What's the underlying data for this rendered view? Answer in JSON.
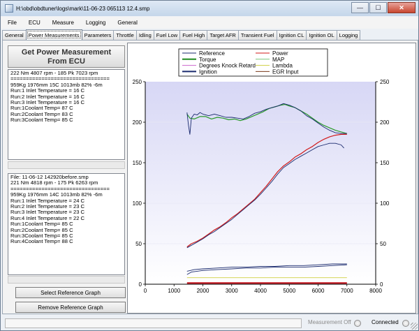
{
  "window": {
    "title": "H:\\obd\\obdtuner\\logs\\mark\\11-06-23 065113 12.4.smp",
    "min_glyph": "—",
    "max_glyph": "☐",
    "close_glyph": "✕"
  },
  "menu": [
    "File",
    "ECU",
    "Measure",
    "Logging",
    "General"
  ],
  "tabs": [
    "General",
    "Power Measurements",
    "Parameters",
    "Throttle",
    "Idling",
    "Fuel Low",
    "Fuel High",
    "Target AFR",
    "Transient Fuel",
    "Ignition CL",
    "Ignition OL",
    "Logging"
  ],
  "active_tab": "Power Measurements",
  "left": {
    "get_power_button": [
      "Get Power Measurement",
      "From ECU"
    ],
    "current_panel": [
      "222 Nm 4807 rpm - 185 Pk 7023 rpm",
      "================================",
      "959Kg 1976mm 15C 1013mb 82% -6m",
      "Run:1 Inlet Temperature = 16 C",
      "Run:2 Inlet Temperature = 16 C",
      "Run:3 Inlet Temperature = 16 C",
      "Run:1Coolant Temp= 87 C",
      "Run:2Coolant Temp= 83 C",
      "Run:3Coolant Temp= 85 C"
    ],
    "reference_panel": [
      "File: 11-06-12 142920before.smp",
      "221 Nm 4818 rpm - 175 Pk 6263 rpm",
      "================================",
      "959Kg 1976mm 14C 1013mb 82% -6m",
      "Run:1 Inlet Temperature = 24 C",
      "Run:2 Inlet Temperature = 23 C",
      "Run:3 Inlet Temperature = 23 C",
      "Run:4 Inlet Temperature = 22 C",
      "Run:1Coolant Temp= 85 C",
      "Run:2Coolant Temp= 85 C",
      "Run:3Coolant Temp= 85 C",
      "Run:4Coolant Temp= 88 C"
    ],
    "select_reference_button": "Select Reference Graph",
    "remove_reference_button": "Remove Reference Graph"
  },
  "status": {
    "measurement": "Measurement Off",
    "connected": "Connected"
  },
  "chart_data": {
    "type": "line",
    "x_ticks": [
      0,
      1000,
      2000,
      3000,
      4000,
      5000,
      6000,
      7000,
      8000
    ],
    "y_ticks": [
      0,
      50,
      100,
      150,
      200,
      250
    ],
    "xlim": [
      0,
      8000
    ],
    "ylim": [
      0,
      250
    ],
    "legend_position": "top",
    "legend": [
      {
        "name": "Reference",
        "color": "#1a2a6e",
        "width": 1
      },
      {
        "name": "Power",
        "color": "#d11a1a",
        "width": 1
      },
      {
        "name": "Torque",
        "color": "#1f8a1f",
        "width": 2
      },
      {
        "name": "MAP",
        "color": "#7cc57c",
        "width": 1
      },
      {
        "name": "Degrees Knock Retard",
        "color": "#cc66cc",
        "width": 1
      },
      {
        "name": "Lambda",
        "color": "#cfcf40",
        "width": 1
      },
      {
        "name": "Ignition",
        "color": "#1a2a6e",
        "width": 2
      },
      {
        "name": "EGR Input",
        "color": "#7a3a1a",
        "width": 1
      }
    ],
    "series": [
      {
        "name": "Torque",
        "color": "#2a9a2a",
        "width": 1.2,
        "x": [
          1450,
          1550,
          1700,
          1900,
          2100,
          2300,
          2500,
          2700,
          2900,
          3100,
          3300,
          3500,
          3700,
          3900,
          4100,
          4300,
          4500,
          4700,
          4850,
          5000,
          5200,
          5400,
          5600,
          5800,
          6000,
          6200,
          6400,
          6600,
          6800,
          7000
        ],
        "y": [
          210,
          205,
          204,
          207,
          207,
          204,
          206,
          205,
          203,
          204,
          202,
          204,
          207,
          210,
          213,
          217,
          219,
          221,
          222,
          220,
          218,
          214,
          210,
          205,
          200,
          196,
          193,
          190,
          188,
          186
        ]
      },
      {
        "name": "Power",
        "color": "#d11a1a",
        "width": 1.2,
        "x": [
          1450,
          1600,
          1800,
          2000,
          2200,
          2400,
          2600,
          2800,
          3000,
          3200,
          3400,
          3600,
          3800,
          4000,
          4200,
          4400,
          4600,
          4800,
          5000,
          5200,
          5400,
          5600,
          5800,
          6000,
          6200,
          6400,
          6600,
          6800,
          7000
        ],
        "y": [
          46,
          50,
          53,
          57,
          62,
          67,
          71,
          76,
          82,
          87,
          93,
          99,
          105,
          113,
          121,
          130,
          139,
          146,
          151,
          157,
          161,
          166,
          170,
          175,
          179,
          182,
          184,
          185,
          185
        ]
      },
      {
        "name": "Reference torque",
        "color": "#1a2a6e",
        "width": 0.9,
        "x": [
          1450,
          1500,
          1550,
          1600,
          1700,
          1800,
          1900,
          2000,
          2200,
          2400,
          2600,
          2800,
          3000,
          3200,
          3400,
          3600,
          3800,
          4000,
          4200,
          4400,
          4600,
          4800,
          5000,
          5200,
          5400,
          5600,
          5800,
          6000,
          6200,
          6400,
          6600,
          6800,
          7000
        ],
        "y": [
          212,
          196,
          185,
          205,
          210,
          209,
          212,
          210,
          208,
          210,
          208,
          206,
          206,
          205,
          204,
          207,
          211,
          213,
          216,
          218,
          220,
          223,
          221,
          218,
          214,
          208,
          204,
          199,
          194,
          190,
          187,
          186,
          186
        ]
      },
      {
        "name": "Reference power",
        "color": "#1a2a6e",
        "width": 0.9,
        "x": [
          1450,
          1600,
          1800,
          2000,
          2200,
          2400,
          2600,
          2800,
          3000,
          3200,
          3400,
          3600,
          3800,
          4000,
          4200,
          4400,
          4600,
          4800,
          5000,
          5200,
          5400,
          5600,
          5800,
          6000,
          6200,
          6400,
          6600,
          6800,
          6900
        ],
        "y": [
          45,
          48,
          52,
          56,
          61,
          65,
          70,
          75,
          80,
          86,
          92,
          98,
          104,
          111,
          119,
          127,
          136,
          144,
          149,
          154,
          158,
          162,
          166,
          170,
          172,
          174,
          174,
          172,
          168
        ]
      },
      {
        "name": "Ignition",
        "color": "#1a2a6e",
        "width": 0.9,
        "x": [
          1450,
          1600,
          2000,
          2500,
          3000,
          3500,
          4000,
          4500,
          5000,
          5500,
          6000,
          6500,
          7000
        ],
        "y": [
          12,
          15,
          17,
          18,
          19,
          20,
          20,
          21,
          21,
          21,
          22,
          23,
          24
        ]
      },
      {
        "name": "Ignition 2",
        "color": "#1a2a6e",
        "width": 0.9,
        "x": [
          1450,
          1700,
          2000,
          2500,
          3000,
          3500,
          4000,
          4500,
          5000,
          5500,
          6000,
          6500,
          7000
        ],
        "y": [
          16,
          18,
          19,
          20,
          21,
          21,
          22,
          22,
          23,
          23,
          24,
          25,
          25
        ]
      },
      {
        "name": "Lambda",
        "color": "#cfcf40",
        "width": 0.9,
        "x": [
          1450,
          7000
        ],
        "y": [
          8,
          8
        ]
      },
      {
        "name": "EGR Input",
        "color": "#c0101a",
        "width": 2.2,
        "x": [
          1450,
          7000
        ],
        "y": [
          1.5,
          1.5
        ]
      }
    ]
  }
}
